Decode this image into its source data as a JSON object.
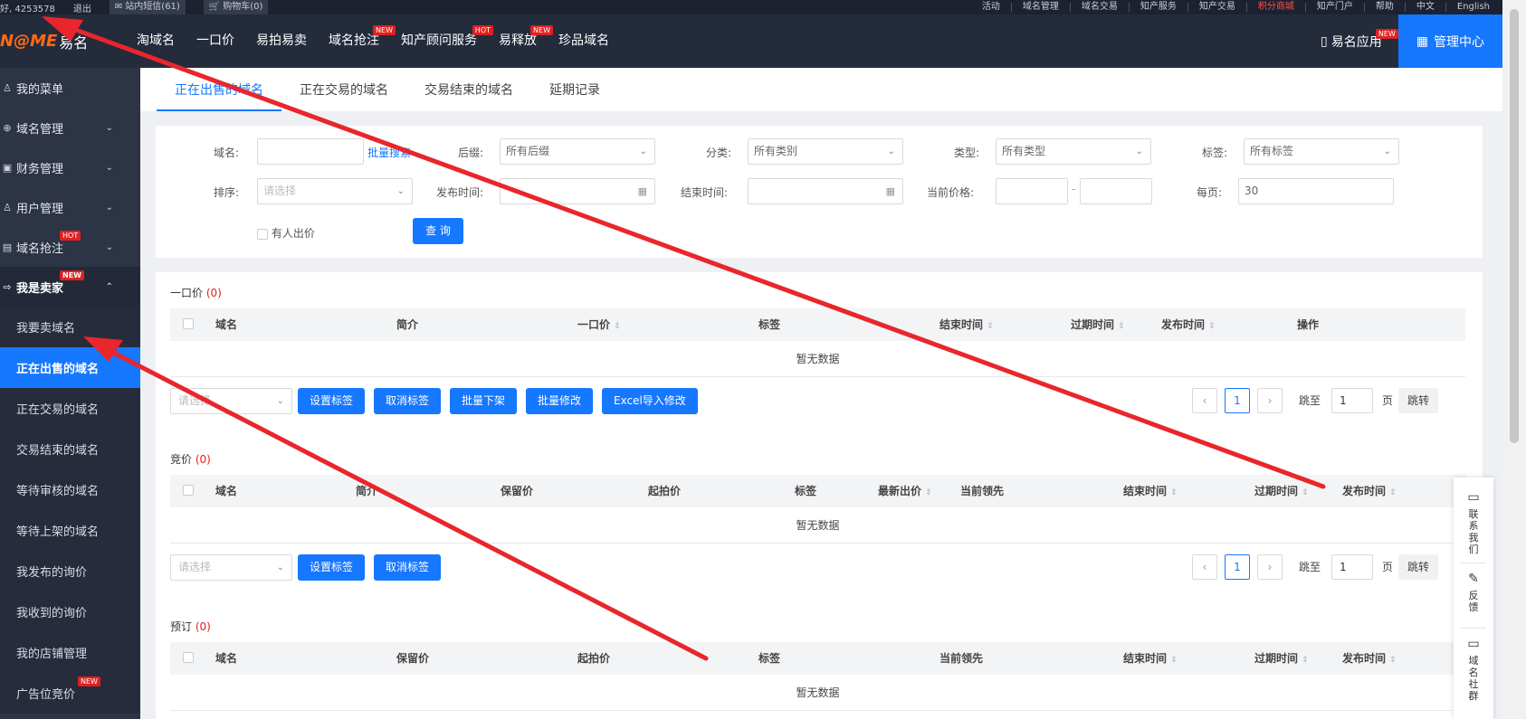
{
  "topbar": {
    "greeting": "好, 4253578",
    "logout": "退出",
    "messages": "站内短信(61)",
    "cart": "购物车(0)",
    "links": [
      "活动",
      "域名管理",
      "域名交易",
      "知产服务",
      "知产交易",
      "积分商城",
      "知产门户",
      "帮助",
      "中文",
      "English"
    ],
    "highlight_link": "积分商城"
  },
  "header": {
    "logo_mark": "N@ME",
    "logo_cn": "易名",
    "nav": [
      {
        "label": "淘域名",
        "badge": ""
      },
      {
        "label": "一口价",
        "badge": ""
      },
      {
        "label": "易拍易卖",
        "badge": ""
      },
      {
        "label": "域名抢注",
        "badge": "NEW"
      },
      {
        "label": "知产顾问服务",
        "badge": "HOT"
      },
      {
        "label": "易释放",
        "badge": "NEW"
      },
      {
        "label": "珍品域名",
        "badge": ""
      }
    ],
    "app_label": "易名应用",
    "app_badge": "NEW",
    "manage_label": "管理中心"
  },
  "sidebar": {
    "groups": [
      {
        "label": "我的菜单",
        "icon": "user-icon",
        "badge": "",
        "chevron": ""
      },
      {
        "label": "域名管理",
        "icon": "globe-icon",
        "badge": "",
        "chevron": "⌄"
      },
      {
        "label": "财务管理",
        "icon": "wallet-icon",
        "badge": "",
        "chevron": "⌄"
      },
      {
        "label": "用户管理",
        "icon": "users-icon",
        "badge": "",
        "chevron": "⌄"
      },
      {
        "label": "域名抢注",
        "icon": "calendar-icon",
        "badge": "HOT",
        "chevron": "⌄"
      },
      {
        "label": "我是卖家",
        "icon": "exit-icon",
        "badge": "NEW",
        "chevron": "⌃"
      }
    ],
    "sub_items": [
      {
        "label": "我要卖域名",
        "badge": ""
      },
      {
        "label": "正在出售的域名",
        "badge": ""
      },
      {
        "label": "正在交易的域名",
        "badge": ""
      },
      {
        "label": "交易结束的域名",
        "badge": ""
      },
      {
        "label": "等待审核的域名",
        "badge": ""
      },
      {
        "label": "等待上架的域名",
        "badge": ""
      },
      {
        "label": "我发布的询价",
        "badge": ""
      },
      {
        "label": "我收到的询价",
        "badge": ""
      },
      {
        "label": "我的店铺管理",
        "badge": ""
      },
      {
        "label": "广告位竞价",
        "badge": "NEW"
      }
    ]
  },
  "tabs": [
    "正在出售的域名",
    "正在交易的域名",
    "交易结束的域名",
    "延期记录"
  ],
  "filter": {
    "domain_label": "域名:",
    "domain_value": "",
    "batch_search": "批量搜索",
    "suffix_label": "后缀:",
    "suffix_value": "所有后缀",
    "category_label": "分类:",
    "category_value": "所有类别",
    "type_label": "类型:",
    "type_value": "所有类型",
    "tag_label": "标签:",
    "tag_value": "所有标签",
    "sort_label": "排序:",
    "sort_placeholder": "请选择",
    "publish_label": "发布时间:",
    "end_label": "结束时间:",
    "price_label": "当前价格:",
    "price_sep": "-",
    "perpage_label": "每页:",
    "perpage_value": "30",
    "has_bid_label": "有人出价",
    "query_button": "查 询"
  },
  "sections": {
    "fixed": {
      "title": "一口价",
      "count": "(0)",
      "columns": [
        "域名",
        "简介",
        "一口价",
        "标签",
        "结束时间",
        "过期时间",
        "发布时间",
        "操作"
      ],
      "empty": "暂无数据",
      "select_placeholder": "请选择",
      "buttons": [
        "设置标签",
        "取消标签",
        "批量下架",
        "批量修改",
        "Excel导入修改"
      ]
    },
    "auction": {
      "title": "竞价",
      "count": "(0)",
      "columns": [
        "域名",
        "简介",
        "保留价",
        "起拍价",
        "标签",
        "最新出价",
        "当前领先",
        "结束时间",
        "过期时间",
        "发布时间"
      ],
      "empty": "暂无数据",
      "select_placeholder": "请选择",
      "buttons": [
        "设置标签",
        "取消标签"
      ]
    },
    "reserve": {
      "title": "预订",
      "count": "(0)",
      "columns": [
        "域名",
        "保留价",
        "起拍价",
        "标签",
        "当前领先",
        "结束时间",
        "过期时间",
        "发布时间"
      ],
      "empty": "暂无数据"
    }
  },
  "pagination": {
    "prev": "‹",
    "next": "›",
    "current": "1",
    "jump_to": "跳至",
    "page_input": "1",
    "page_unit": "页",
    "jump_button": "跳转"
  },
  "floatbar": {
    "contact": [
      "联",
      "系",
      "我",
      "们"
    ],
    "feedback": [
      "反",
      "馈"
    ],
    "community": [
      "域",
      "名",
      "社",
      "群"
    ]
  },
  "colors": {
    "accent": "#1677ff",
    "header_bg": "#242b3b",
    "sidebar_bg": "#2d3445",
    "badge": "#e02020",
    "annotation_arrow": "#e8262b"
  }
}
